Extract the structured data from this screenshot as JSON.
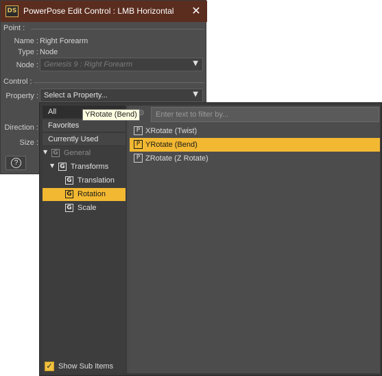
{
  "window": {
    "logo_text": "DS",
    "title": "PowerPose Edit Control : LMB Horizontal",
    "close_symbol": "✕"
  },
  "point": {
    "section_label": "Point :",
    "name_label": "Name :",
    "name_value": "Right Forearm",
    "type_label": "Type :",
    "type_value": "Node",
    "node_label": "Node :",
    "node_value": "Genesis 9 : Right Forearm"
  },
  "control": {
    "section_label": "Control :",
    "property_label": "Property :",
    "property_value": "Select a Property...",
    "direction_label": "Direction :",
    "size_label": "Size :"
  },
  "help_button": {
    "symbol": "?"
  },
  "tooltip": {
    "text": "YRotate (Bend)"
  },
  "popup": {
    "tabs": [
      {
        "label": "All",
        "active": true
      },
      {
        "label": "Favorites",
        "active": false
      },
      {
        "label": "Currently Used",
        "active": false
      }
    ],
    "tree": {
      "general": {
        "label": "General",
        "icon": "G"
      },
      "transforms": {
        "label": "Transforms",
        "icon": "G"
      },
      "translation": {
        "label": "Translation",
        "icon": "G"
      },
      "rotation": {
        "label": "Rotation",
        "icon": "G",
        "selected": true
      },
      "scale": {
        "label": "Scale",
        "icon": "G"
      }
    },
    "filter": {
      "placeholder": "Enter text to filter by..."
    },
    "properties": [
      {
        "label": "XRotate (Twist)",
        "icon": "P",
        "selected": false
      },
      {
        "label": "YRotate (Bend)",
        "icon": "P",
        "selected": true
      },
      {
        "label": "ZRotate (Z Rotate)",
        "icon": "P",
        "selected": false
      }
    ],
    "show_sub_items": {
      "label": "Show Sub Items",
      "checked": true,
      "check_mark": "✓"
    }
  },
  "colors": {
    "title_bar": "#5b2d1f",
    "panel": "#4d4d4d",
    "selection": "#f2b831",
    "tooltip_bg": "#ffffe1"
  }
}
